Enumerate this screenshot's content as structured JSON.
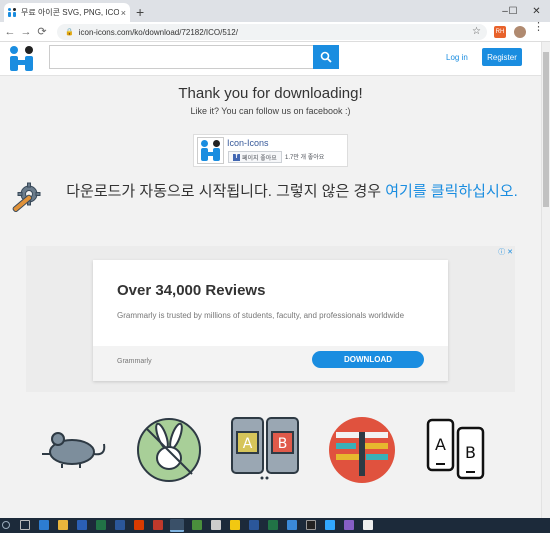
{
  "browser": {
    "tab_title": "무료 아이콘 SVG, PNG, ICO 또는",
    "tab_close": "×",
    "new_tab": "+",
    "url": "icon-icons.com/ko/download/72182/ICO/512/",
    "window_min": "–",
    "window_max": "☐",
    "window_close": "✕",
    "back": "←",
    "forward": "→",
    "reload": "⟳",
    "star": "☆",
    "lock": "🔒",
    "menu": "⋮",
    "ext_badge": "RH"
  },
  "header": {
    "login_label": "Log in",
    "register_label": "Register",
    "search_placeholder": ""
  },
  "thanks": {
    "title": "Thank you for downloading!",
    "subtitle": "Like it? You can follow us on facebook :)"
  },
  "facebook": {
    "page_name": "Icon-Icons",
    "like_label": "페이지 좋아요",
    "like_f": "f",
    "count": "1.7만 개 좋아요"
  },
  "download_notice": {
    "text": "다운로드가 자동으로 시작됩니다. 그렇지 않은 경우 ",
    "link": "여기를 클릭하십시오."
  },
  "ad": {
    "title": "Over 34,000 Reviews",
    "description": "Grammarly is trusted by millions of students, faculty, and professionals worldwide",
    "brand": "Grammarly",
    "button": "DOWNLOAD",
    "close": "ⓘ ✕"
  },
  "icons": [
    "mouse-icon",
    "rabbit-icon",
    "ab-test-icon",
    "ui-layout-icon",
    "ab-phones-icon"
  ],
  "colors": {
    "accent": "#1a8de0",
    "taskbar": "#1c2a3a"
  }
}
